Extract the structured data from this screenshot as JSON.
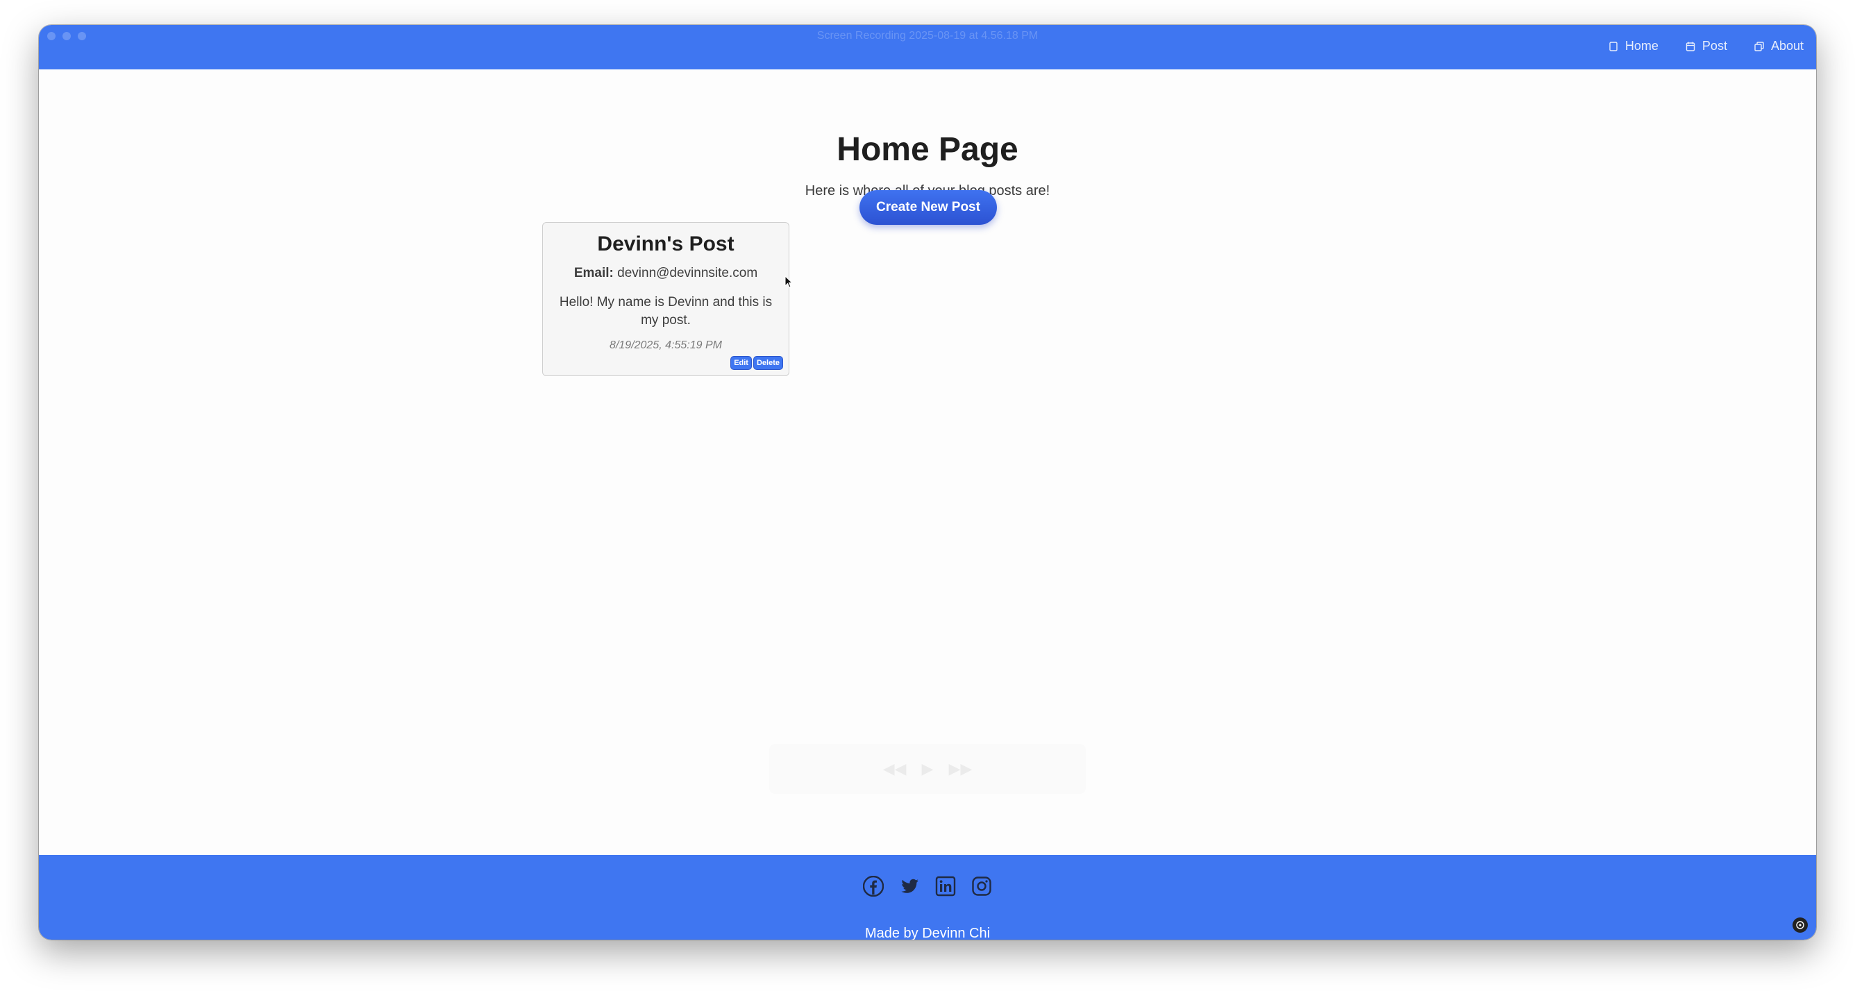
{
  "window": {
    "title": "Screen Recording 2025-08-19 at 4.56.18 PM"
  },
  "nav": {
    "items": [
      {
        "label": "Home",
        "icon": "page-icon"
      },
      {
        "label": "Post",
        "icon": "calendar-icon"
      },
      {
        "label": "About",
        "icon": "copy-icon"
      }
    ]
  },
  "main": {
    "title": "Home Page",
    "subtitle": "Here is where all of your blog posts are!",
    "create_button": "Create New Post"
  },
  "post": {
    "title": "Devinn's Post",
    "email_label": "Email:",
    "email": "devinn@devinnsite.com",
    "body": "Hello! My name is Devinn and this is my post.",
    "date": "8/19/2025, 4:55:19 PM",
    "edit_label": "Edit",
    "delete_label": "Delete"
  },
  "footer": {
    "socials": [
      "facebook-icon",
      "twitter-icon",
      "linkedin-icon",
      "instagram-icon"
    ],
    "made_by": "Made by Devinn Chi"
  },
  "colors": {
    "brand_blue": "#3f76f1",
    "button_blue": "#2c52d2"
  }
}
